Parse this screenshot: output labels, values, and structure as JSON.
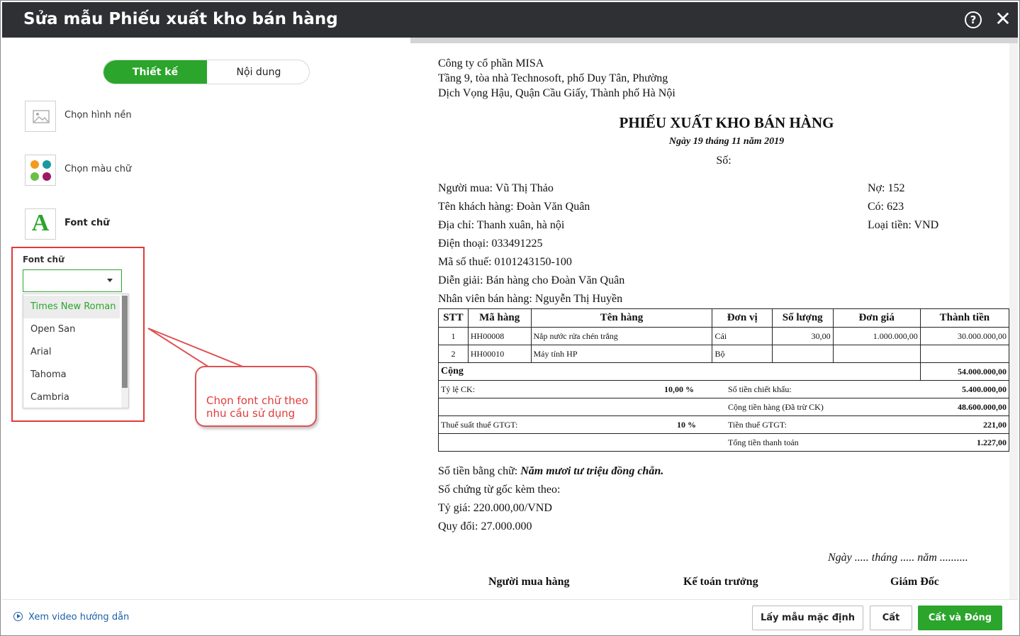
{
  "window": {
    "title": "Sửa mẫu Phiếu xuất kho bán hàng",
    "help_icon": "?",
    "close_icon": "✕"
  },
  "tabs": [
    {
      "label": "Thiết kế",
      "active": true
    },
    {
      "label": "Nội dung",
      "active": false
    }
  ],
  "tools": [
    {
      "label": "Chọn hình nền",
      "icon": "image-icon"
    },
    {
      "label": "Chọn màu chữ",
      "icon": "palette-icon"
    },
    {
      "label": "Font chữ",
      "icon": "font-icon",
      "glyph": "A"
    }
  ],
  "font_panel": {
    "label": "Font chữ",
    "selected": "",
    "options": [
      "Times New Roman",
      "Open San",
      "Arial",
      "Tahoma",
      "Cambria"
    ],
    "highlighted": "Times New Roman"
  },
  "callout": {
    "text": "Chọn font chữ theo nhu cầu sử dụng"
  },
  "colors": {
    "accent": "#2ba52b",
    "callout": "#e33a3a",
    "titlebar": "#2f3033"
  },
  "document": {
    "company": [
      "Công ty cổ phần MISA",
      "Tầng 9, tòa nhà Technosoft, phố Duy Tân, Phường",
      "Dịch Vọng Hậu, Quận Cầu Giấy, Thành phố Hà Nội"
    ],
    "title": "PHIẾU XUẤT KHO BÁN HÀNG",
    "date": "Ngày 19 tháng 11 năm 2019",
    "so": "Số:",
    "info_left": [
      "Người mua: Vũ Thị Thảo",
      "Tên khách hàng: Đoàn Văn Quân",
      "Địa chỉ: Thanh xuân, hà nội",
      "Điện thoại: 033491225",
      "Mã số thuế: 0101243150-100",
      "Diễn giải: Bán hàng cho Đoàn Văn Quân",
      "Nhân viên bán hàng: Nguyễn Thị Huyền"
    ],
    "info_right": [
      "Nợ: 152",
      "Có: 623",
      "Loại tiền: VND"
    ],
    "table": {
      "headers": [
        "STT",
        "Mã hàng",
        "Tên hàng",
        "Đơn vị",
        "Số lượng",
        "Đơn giá",
        "Thành tiền"
      ],
      "rows": [
        [
          "1",
          "HH00008",
          "Nắp nước rửa chén trắng",
          "Cái",
          "30,00",
          "1.000.000,00",
          "30.000.000,00"
        ],
        [
          "2",
          "HH00010",
          "Máy tính HP",
          "Bộ",
          "",
          "",
          ""
        ]
      ],
      "cong_label": "Cộng",
      "cong_value": "54.000.000,00",
      "ck_label": "Tỷ lệ CK:",
      "ck_rate": "10,00 %",
      "ck_amount_label": "Số tiền chiết khấu:",
      "ck_amount": "5.400.000,00",
      "cong_tien_label": "Cộng tiền hàng (Đã trừ CK)",
      "cong_tien": "48.600.000,00",
      "vat_label": "Thuế suất thuế GTGT:",
      "vat_rate": "10 %",
      "vat_amount_label": "Tiền thuế GTGT:",
      "vat_amount": "221,00",
      "total_label": "Tổng tiền thanh toán",
      "total": "1.227,00"
    },
    "words_label": "Số tiền bằng chữ:",
    "words_value": "Năm mươi tư triệu đồng chẵn.",
    "so_chung_tu": "Số chứng từ gốc kèm theo:",
    "ty_gia": "Tỷ giá: 220.000,00/VND",
    "quy_doi": "Quy đổi: 27.000.000",
    "sign_date": "Ngày ..... tháng ..... năm ..........",
    "signers": [
      "Người mua hàng",
      "Kế toán trưởng",
      "Giám Đốc"
    ]
  },
  "footer": {
    "video_link": "Xem video hướng dẫn",
    "btn_default": "Lấy mẫu mặc định",
    "btn_save": "Cất",
    "btn_save_close": "Cất và Đóng"
  }
}
